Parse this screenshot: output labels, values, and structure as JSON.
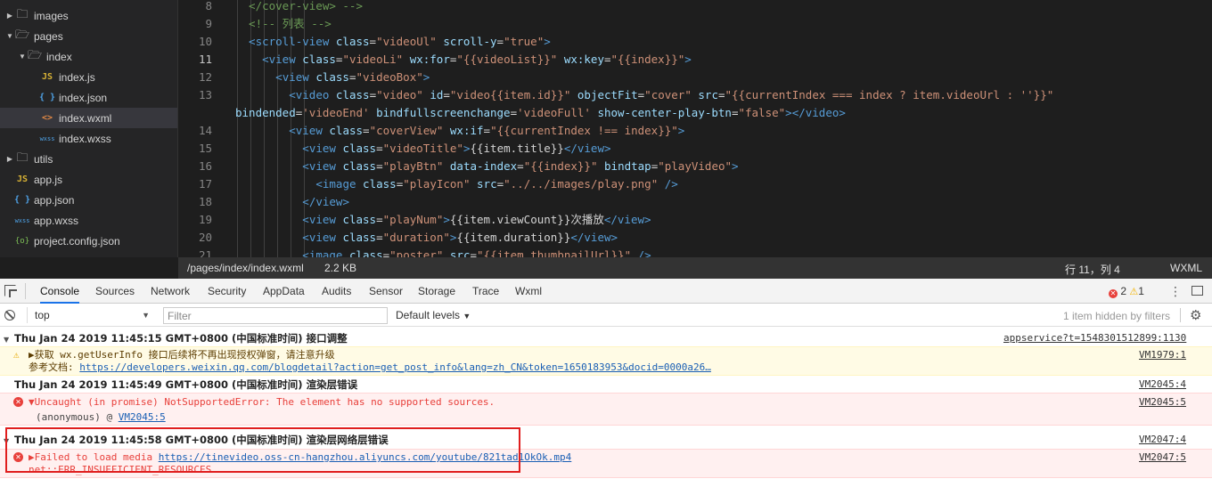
{
  "file_tree": [
    {
      "label": "images",
      "type": "folder",
      "expanded": false,
      "depth": 0
    },
    {
      "label": "pages",
      "type": "folder",
      "expanded": true,
      "depth": 0
    },
    {
      "label": "index",
      "type": "folder",
      "expanded": true,
      "depth": 1
    },
    {
      "label": "index.js",
      "type": "js",
      "icon_text": "JS",
      "depth": 2
    },
    {
      "label": "index.json",
      "type": "json",
      "icon_text": "{ }",
      "depth": 2
    },
    {
      "label": "index.wxml",
      "type": "wxml",
      "icon_text": "<>",
      "depth": 2,
      "selected": true
    },
    {
      "label": "index.wxss",
      "type": "wxss",
      "icon_text": "wxss",
      "depth": 2
    },
    {
      "label": "utils",
      "type": "folder",
      "expanded": false,
      "depth": 0
    },
    {
      "label": "app.js",
      "type": "js",
      "icon_text": "JS",
      "depth": 0
    },
    {
      "label": "app.json",
      "type": "json",
      "icon_text": "{ }",
      "depth": 0
    },
    {
      "label": "app.wxss",
      "type": "wxss",
      "icon_text": "wxss",
      "depth": 0
    },
    {
      "label": "project.config.json",
      "type": "config",
      "icon_text": "{o}",
      "depth": 0
    }
  ],
  "code_lines": [
    {
      "num": "8",
      "indent": 2,
      "tokens": [
        {
          "t": "cmt",
          "v": "</cover-view> -->"
        }
      ]
    },
    {
      "num": "9",
      "indent": 2,
      "tokens": [
        {
          "t": "cmt",
          "v": "<!-- 列表 -->"
        }
      ]
    },
    {
      "num": "10",
      "indent": 2,
      "tokens": [
        {
          "t": "tag",
          "v": "<scroll-view "
        },
        {
          "t": "attr",
          "v": "class"
        },
        {
          "t": "plain",
          "v": "="
        },
        {
          "t": "val",
          "v": "\"videoUl\""
        },
        {
          "t": "plain",
          "v": " "
        },
        {
          "t": "attr",
          "v": "scroll-y"
        },
        {
          "t": "plain",
          "v": "="
        },
        {
          "t": "val",
          "v": "\"true\""
        },
        {
          "t": "tag",
          "v": ">"
        }
      ]
    },
    {
      "num": "11",
      "indent": 4,
      "current": true,
      "tokens": [
        {
          "t": "tag",
          "v": "<view "
        },
        {
          "t": "attr",
          "v": "class"
        },
        {
          "t": "plain",
          "v": "="
        },
        {
          "t": "val",
          "v": "\"videoLi\""
        },
        {
          "t": "plain",
          "v": " "
        },
        {
          "t": "attr",
          "v": "wx:for"
        },
        {
          "t": "plain",
          "v": "="
        },
        {
          "t": "val",
          "v": "\"{{videoList}}\""
        },
        {
          "t": "plain",
          "v": " "
        },
        {
          "t": "attr",
          "v": "wx:key"
        },
        {
          "t": "plain",
          "v": "="
        },
        {
          "t": "val",
          "v": "\"{{index}}\""
        },
        {
          "t": "tag",
          "v": ">"
        }
      ]
    },
    {
      "num": "12",
      "indent": 6,
      "tokens": [
        {
          "t": "tag",
          "v": "<view "
        },
        {
          "t": "attr",
          "v": "class"
        },
        {
          "t": "plain",
          "v": "="
        },
        {
          "t": "val",
          "v": "\"videoBox\""
        },
        {
          "t": "tag",
          "v": ">"
        }
      ]
    },
    {
      "num": "13",
      "indent": 8,
      "tokens": [
        {
          "t": "tag",
          "v": "<video "
        },
        {
          "t": "attr",
          "v": "class"
        },
        {
          "t": "plain",
          "v": "="
        },
        {
          "t": "val",
          "v": "\"video\""
        },
        {
          "t": "plain",
          "v": " "
        },
        {
          "t": "attr",
          "v": "id"
        },
        {
          "t": "plain",
          "v": "="
        },
        {
          "t": "val",
          "v": "\"video{{item.id}}\""
        },
        {
          "t": "plain",
          "v": " "
        },
        {
          "t": "attr",
          "v": "objectFit"
        },
        {
          "t": "plain",
          "v": "="
        },
        {
          "t": "val",
          "v": "\"cover\""
        },
        {
          "t": "plain",
          "v": " "
        },
        {
          "t": "attr",
          "v": "src"
        },
        {
          "t": "plain",
          "v": "="
        },
        {
          "t": "val",
          "v": "\"{{currentIndex === index ? item.videoUrl : ''}}\""
        }
      ]
    },
    {
      "num": "",
      "indent": 0,
      "wrap": true,
      "tokens": [
        {
          "t": "attr",
          "v": "bindended"
        },
        {
          "t": "plain",
          "v": "="
        },
        {
          "t": "val",
          "v": "'videoEnd'"
        },
        {
          "t": "plain",
          "v": " "
        },
        {
          "t": "attr",
          "v": "bindfullscreenchange"
        },
        {
          "t": "plain",
          "v": "="
        },
        {
          "t": "val",
          "v": "'videoFull'"
        },
        {
          "t": "plain",
          "v": " "
        },
        {
          "t": "attr",
          "v": "show-center-play-btn"
        },
        {
          "t": "plain",
          "v": "="
        },
        {
          "t": "val",
          "v": "\"false\""
        },
        {
          "t": "tag",
          "v": "></video>"
        }
      ]
    },
    {
      "num": "14",
      "indent": 8,
      "tokens": [
        {
          "t": "tag",
          "v": "<view "
        },
        {
          "t": "attr",
          "v": "class"
        },
        {
          "t": "plain",
          "v": "="
        },
        {
          "t": "val",
          "v": "\"coverView\""
        },
        {
          "t": "plain",
          "v": " "
        },
        {
          "t": "attr",
          "v": "wx:if"
        },
        {
          "t": "plain",
          "v": "="
        },
        {
          "t": "val",
          "v": "\"{{currentIndex !== index}}\""
        },
        {
          "t": "tag",
          "v": ">"
        }
      ]
    },
    {
      "num": "15",
      "indent": 10,
      "tokens": [
        {
          "t": "tag",
          "v": "<view "
        },
        {
          "t": "attr",
          "v": "class"
        },
        {
          "t": "plain",
          "v": "="
        },
        {
          "t": "val",
          "v": "\"videoTitle\""
        },
        {
          "t": "tag",
          "v": ">"
        },
        {
          "t": "plain",
          "v": "{{item.title}}"
        },
        {
          "t": "tag",
          "v": "</view>"
        }
      ]
    },
    {
      "num": "16",
      "indent": 10,
      "tokens": [
        {
          "t": "tag",
          "v": "<view "
        },
        {
          "t": "attr",
          "v": "class"
        },
        {
          "t": "plain",
          "v": "="
        },
        {
          "t": "val",
          "v": "\"playBtn\""
        },
        {
          "t": "plain",
          "v": " "
        },
        {
          "t": "attr",
          "v": "data-index"
        },
        {
          "t": "plain",
          "v": "="
        },
        {
          "t": "val",
          "v": "\"{{index}}\""
        },
        {
          "t": "plain",
          "v": " "
        },
        {
          "t": "attr",
          "v": "bindtap"
        },
        {
          "t": "plain",
          "v": "="
        },
        {
          "t": "val",
          "v": "\"playVideo\""
        },
        {
          "t": "tag",
          "v": ">"
        }
      ]
    },
    {
      "num": "17",
      "indent": 12,
      "tokens": [
        {
          "t": "tag",
          "v": "<image "
        },
        {
          "t": "attr",
          "v": "class"
        },
        {
          "t": "plain",
          "v": "="
        },
        {
          "t": "val",
          "v": "\"playIcon\""
        },
        {
          "t": "plain",
          "v": " "
        },
        {
          "t": "attr",
          "v": "src"
        },
        {
          "t": "plain",
          "v": "="
        },
        {
          "t": "val",
          "v": "\"../../images/play.png\""
        },
        {
          "t": "plain",
          "v": " "
        },
        {
          "t": "tag",
          "v": "/>"
        }
      ]
    },
    {
      "num": "18",
      "indent": 10,
      "tokens": [
        {
          "t": "tag",
          "v": "</view>"
        }
      ]
    },
    {
      "num": "19",
      "indent": 10,
      "tokens": [
        {
          "t": "tag",
          "v": "<view "
        },
        {
          "t": "attr",
          "v": "class"
        },
        {
          "t": "plain",
          "v": "="
        },
        {
          "t": "val",
          "v": "\"playNum\""
        },
        {
          "t": "tag",
          "v": ">"
        },
        {
          "t": "plain",
          "v": "{{item.viewCount}}次播放"
        },
        {
          "t": "tag",
          "v": "</view>"
        }
      ]
    },
    {
      "num": "20",
      "indent": 10,
      "tokens": [
        {
          "t": "tag",
          "v": "<view "
        },
        {
          "t": "attr",
          "v": "class"
        },
        {
          "t": "plain",
          "v": "="
        },
        {
          "t": "val",
          "v": "\"duration\""
        },
        {
          "t": "tag",
          "v": ">"
        },
        {
          "t": "plain",
          "v": "{{item.duration}}"
        },
        {
          "t": "tag",
          "v": "</view>"
        }
      ]
    },
    {
      "num": "21",
      "indent": 10,
      "tokens": [
        {
          "t": "tag",
          "v": "<image "
        },
        {
          "t": "attr",
          "v": "class"
        },
        {
          "t": "plain",
          "v": "="
        },
        {
          "t": "val",
          "v": "\"poster\""
        },
        {
          "t": "plain",
          "v": " "
        },
        {
          "t": "attr",
          "v": "src"
        },
        {
          "t": "plain",
          "v": "="
        },
        {
          "t": "val",
          "v": "\"{{item.thumbnailUrl}}\""
        },
        {
          "t": "plain",
          "v": " "
        },
        {
          "t": "tag",
          "v": "/>"
        }
      ]
    }
  ],
  "editor_status": {
    "path": "/pages/index/index.wxml",
    "size": "2.2 KB",
    "position": "行 11，列 4",
    "language": "WXML"
  },
  "devtools": {
    "tabs": [
      "Console",
      "Sources",
      "Network",
      "Security",
      "AppData",
      "Audits",
      "Sensor",
      "Storage",
      "Trace",
      "Wxml"
    ],
    "active_tab": "Console",
    "error_count": "2",
    "warning_count": "1",
    "context": "top",
    "filter_placeholder": "Filter",
    "levels": "Default levels",
    "hidden_note": "1 item hidden by filters"
  },
  "console": {
    "group1": {
      "header": "Thu Jan 24 2019 11:45:15 GMT+0800 (中国标准时间) 接口调整",
      "source": "appservice?t=1548301512899:1130",
      "warn_line1": "▶获取 wx.getUserInfo 接口后续将不再出现授权弹窗，请注意升级",
      "warn_line2_prefix": "参考文档: ",
      "warn_link": "https://developers.weixin.qq.com/blogdetail?action=get_post_info&lang=zh_CN&token=1650183953&docid=0000a26…",
      "warn_source": "VM1979:1"
    },
    "group2": {
      "header": "Thu Jan 24 2019 11:45:49 GMT+0800 (中国标准时间) 渲染层错误",
      "source": "VM2045:4",
      "err_line1": "▼Uncaught (in promise) NotSupportedError: The element has no supported sources.",
      "err_line2_prefix": "(anonymous) @ ",
      "err_link": "VM2045:5",
      "err_source": "VM2045:5"
    },
    "group3": {
      "header": "Thu Jan 24 2019 11:45:58 GMT+0800 (中国标准时间) 渲染层网络层错误",
      "source": "VM2047:4",
      "err_line1_prefix": "▶Failed to load media ",
      "err_link": "https://tinevideo.oss-cn-hangzhou.aliyuncs.com/youtube/821tad1OkOk.mp4",
      "err_line2": "net::ERR_INSUFFICIENT_RESOURCES",
      "err_source": "VM2047:5"
    }
  },
  "colors": {
    "editor_bg": "#1e1e1e",
    "sidebar_bg": "#252526",
    "error_red": "#e8403b",
    "highlight_box": "#e01e1e"
  }
}
